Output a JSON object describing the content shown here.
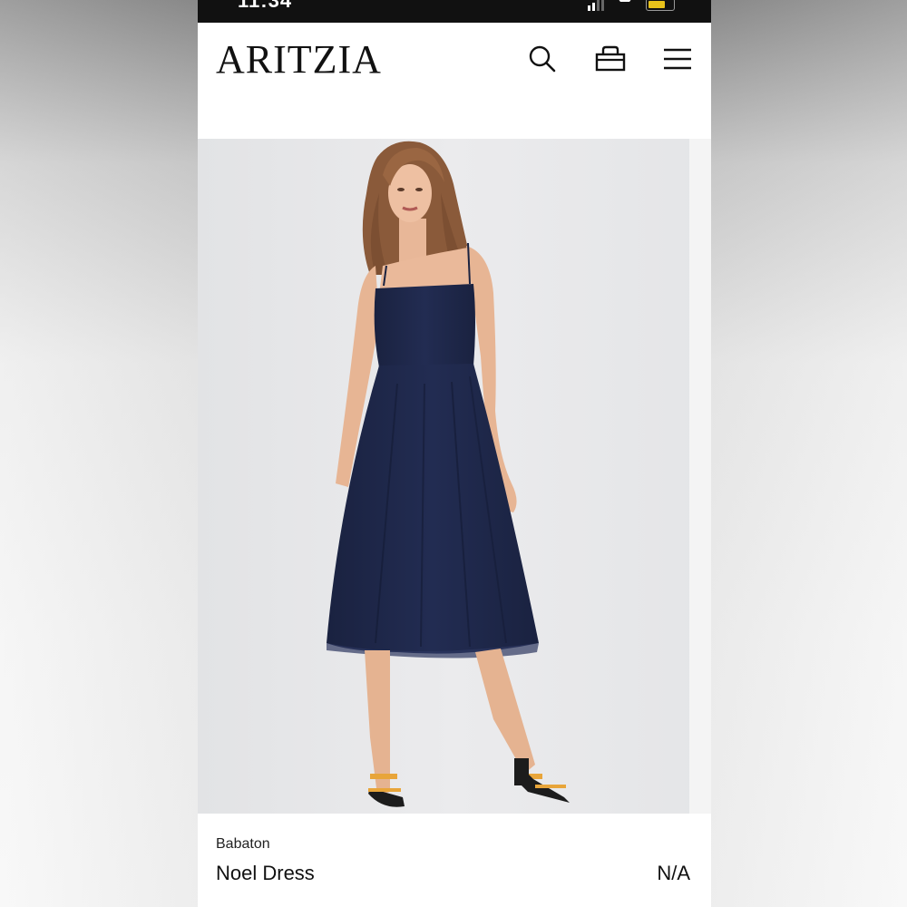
{
  "status_bar": {
    "time": "11:34",
    "battery_color": "#e8c21a"
  },
  "header": {
    "logo_text": "ARITZIA",
    "icons": [
      "search-icon",
      "shopping-bag-icon",
      "menu-icon"
    ]
  },
  "product": {
    "image_alt": "model wearing navy strappy midi dress",
    "dress_color": "#1c2545",
    "brand": "Babaton",
    "name": "Noel Dress",
    "price": "N/A"
  }
}
